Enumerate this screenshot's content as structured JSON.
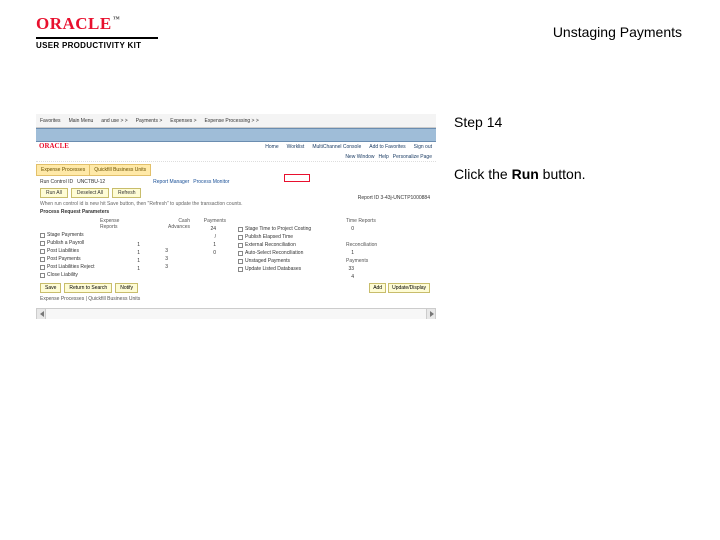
{
  "brand": {
    "logo_text": "ORACLE",
    "tm": "™",
    "subtitle": "USER PRODUCTIVITY KIT"
  },
  "doc_title": "Unstaging Payments",
  "step_label": "Step 14",
  "instruction_pre": "Click the ",
  "instruction_bold": "Run",
  "instruction_post": " button.",
  "shot": {
    "tabs": {
      "favorites": "Favorites",
      "mainmenu": "Main Menu",
      "bc1": "and use > >",
      "bc2": "Payments >",
      "bc3": "Expenses >",
      "bc4": "Expense Processing > >"
    },
    "oracle": "ORACLE",
    "topmenu": {
      "home": "Home",
      "worklist": "Worklist",
      "multichannel": "MultiChannel Console",
      "addto": "Add to Favorites",
      "signout": "Sign out"
    },
    "sub2": {
      "window": "New Window",
      "help": "Help",
      "personalize": "Personalize Page",
      "em": ""
    },
    "ptabs": {
      "t1": "Expense Processes",
      "t2": "Quickfill Business Units"
    },
    "row1": {
      "rc": "Run Control ID",
      "rcv": "UNCTBU-12",
      "rm": "Report Manager",
      "pm": "Process Monitor"
    },
    "btns": {
      "r": "Run All",
      "d": "Deselect All",
      "f": "Refresh"
    },
    "note": "When run control id is new hit Save button, then \"Refresh\" to update the transaction counts.",
    "hdr": "Process Request Parameters",
    "reportid": "Report ID   3-43j-UNCTP1000884",
    "cols": {
      "c1h": "Expense Reports",
      "c1r1": "Stage Payments",
      "c1r2": "Publish a Payroll",
      "c1r3": "Post Liabilities",
      "c1r4": "Post Payments",
      "c1r5": "Post Liabilities Reject",
      "c1r6": "Close Liability",
      "c2h": "Cash Advances",
      "c3h": "Payments",
      "v1": "1",
      "v0": "0",
      "v24": "24",
      "vd": "/",
      "v3": "3",
      "r1": "Stage Time to Project Costing",
      "r2": "Publish Elapsed Time",
      "r3": "External Reconciliation",
      "r4": "Auto-Select Reconciliation",
      "r5": "Unstaged Payments",
      "r6": "Update Listed Databases",
      "v33": "33",
      "v4": "4",
      "th": "Time Reports",
      "tv": "0",
      "rh": "Reconciliation",
      "pv": "Payments"
    },
    "bot": {
      "save": "Save",
      "ret": "Return to Search",
      "not": "Notify",
      "add": "Add",
      "upd": "Update/Display"
    },
    "updated": "Expense Processes | Quickfill Business Units"
  }
}
